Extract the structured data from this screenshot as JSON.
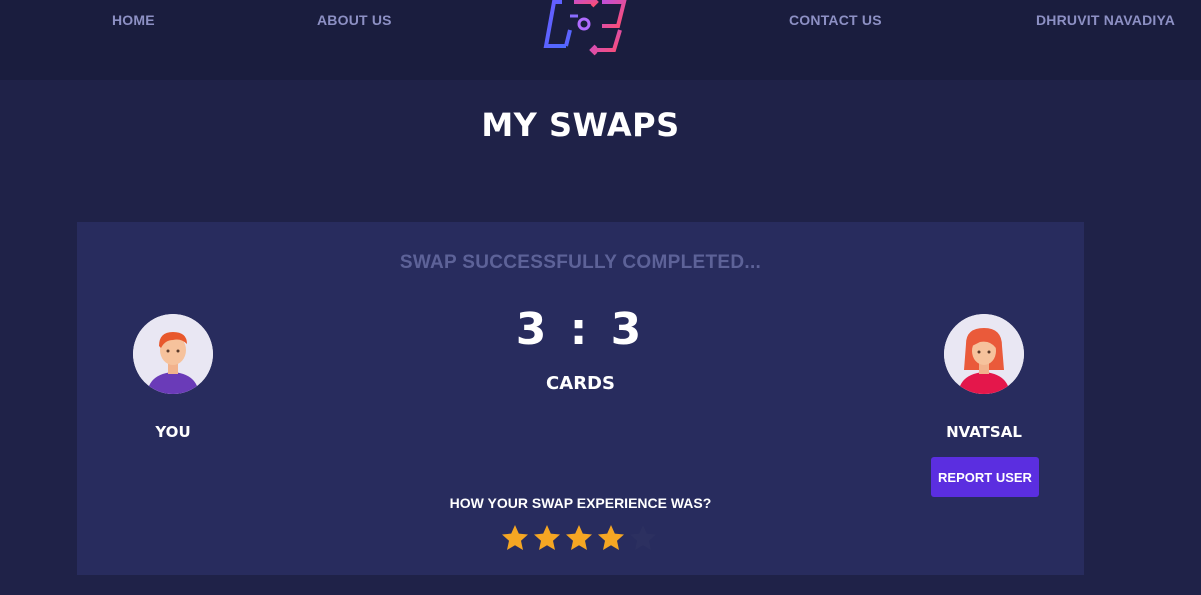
{
  "nav": {
    "home": "HOME",
    "about": "ABOUT US",
    "contact": "CONTACT US",
    "user": "DHRUVIT NAVADIYA"
  },
  "page_title": "MY SWAPS",
  "swap": {
    "status": "SWAP SUCCESSFULLY COMPLETED...",
    "score": "3 : 3",
    "unit": "CARDS",
    "left_user": "YOU",
    "right_user": "NVATSAL",
    "report_button": "REPORT USER",
    "question": "HOW YOUR SWAP EXPERIENCE WAS?",
    "rating": 4,
    "rating_max": 5
  },
  "colors": {
    "background": "#1f2248",
    "navbar": "#1a1d3e",
    "card": "#282c5e",
    "accent": "#5b2ee0",
    "star_filled": "#f5a623",
    "star_empty": "#2c3060"
  },
  "icons": {
    "logo": "swap-arrows-logo",
    "left_avatar": "male-avatar-icon",
    "right_avatar": "female-avatar-icon",
    "star": "star-icon"
  }
}
